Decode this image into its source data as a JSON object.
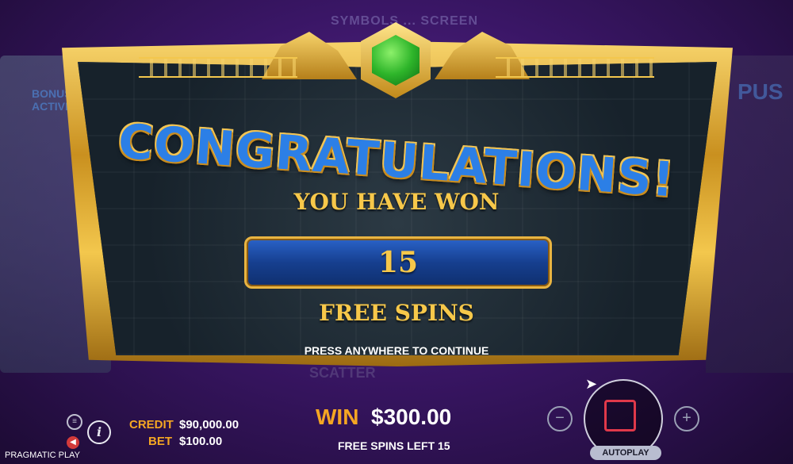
{
  "background": {
    "top_text": "SYMBOLS ... SCREEN",
    "left_text": "BONUS ACTIVE",
    "right_text": "PUS",
    "scatter_text": "SCATTER"
  },
  "dialog": {
    "title": "CONGRATULATIONS!",
    "subtitle": "YOU HAVE WON",
    "amount": "15",
    "unit": "FREE SPINS",
    "prompt": "PRESS ANYWHERE TO CONTINUE"
  },
  "footer": {
    "brand": "PRAGMATIC PLAY",
    "credit_label": "CREDIT",
    "credit_value": "$90,000.00",
    "bet_label": "BET",
    "bet_value": "$100.00",
    "win_label": "WIN",
    "win_value": "$300.00",
    "spins_left": "FREE SPINS LEFT 15",
    "info_icon_glyph": "i",
    "minus_glyph": "−",
    "plus_glyph": "+",
    "autoplay_label": "AUTOPLAY"
  },
  "colors": {
    "accent_gold": "#f7c84a",
    "title_blue": "#2c7fe6",
    "stop_red": "#e0394a",
    "win_orange": "#f5a623"
  },
  "icons": [
    "menu-icon",
    "sound-icon",
    "info-icon",
    "minus-icon",
    "plus-icon",
    "stop-icon",
    "cursor-icon",
    "green-gem-icon"
  ]
}
